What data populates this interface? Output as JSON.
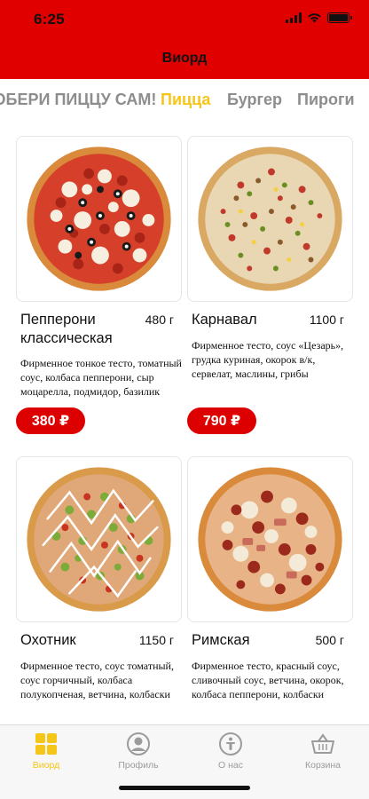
{
  "status_bar": {
    "time": "6:25"
  },
  "header": {
    "title": "Виорд"
  },
  "categories": [
    {
      "label": "СОБЕРИ ПИЦЦУ САМ!",
      "active": false
    },
    {
      "label": "Пицца",
      "active": true
    },
    {
      "label": "Бургер",
      "active": false
    },
    {
      "label": "Пироги",
      "active": false
    }
  ],
  "products": [
    {
      "name": "Пепперони классическая",
      "weight": "480 г",
      "description": "Фирменное тонкое тесто, томатный соус, колбаса пепперони, сыр моцарелла, подмидор, базилик",
      "price": "380 ₽"
    },
    {
      "name": "Карнавал",
      "weight": "1100 г",
      "description": "Фирменное тесто, соус «Цезарь», грудка куриная, окорок в/к, сервелат, маслины, грибы",
      "price": "790 ₽"
    },
    {
      "name": "Охотник",
      "weight": "1150 г",
      "description": "Фирменное тесто, соус томатный, соус горчичный, колбаса полукопченая, ветчина, колбаски"
    },
    {
      "name": "Римская",
      "weight": "500 г",
      "description": "Фирменное тесто, красный соус, сливочный соус, ветчина, окорок, колбаса пепперони, колбаски"
    }
  ],
  "tabbar": {
    "items": [
      {
        "label": "Виорд",
        "icon": "grid-icon",
        "active": true
      },
      {
        "label": "Профиль",
        "icon": "profile-icon",
        "active": false
      },
      {
        "label": "О нас",
        "icon": "info-icon",
        "active": false
      },
      {
        "label": "Корзина",
        "icon": "basket-icon",
        "active": false
      }
    ]
  },
  "colors": {
    "header": "#e00000",
    "accent": "#f5c518",
    "price_button": "#dd0000",
    "inactive": "#8d8d8d"
  }
}
